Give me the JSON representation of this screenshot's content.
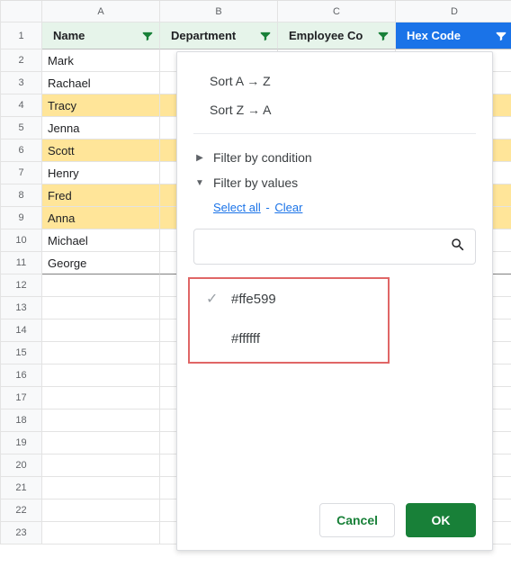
{
  "columns": [
    "A",
    "B",
    "C",
    "D"
  ],
  "row_numbers": [
    1,
    2,
    3,
    4,
    5,
    6,
    7,
    8,
    9,
    10,
    11,
    12,
    13,
    14,
    15,
    16,
    17,
    18,
    19,
    20,
    21,
    22,
    23
  ],
  "headers": {
    "A": "Name",
    "B": "Department",
    "C": "Employee Co",
    "D": "Hex Code"
  },
  "active_filter_col": "D",
  "rows": [
    {
      "name": "Mark",
      "hl": false
    },
    {
      "name": "Rachael",
      "hl": false
    },
    {
      "name": "Tracy",
      "hl": true
    },
    {
      "name": "Jenna",
      "hl": false
    },
    {
      "name": "Scott",
      "hl": true
    },
    {
      "name": "Henry",
      "hl": false
    },
    {
      "name": "Fred",
      "hl": true
    },
    {
      "name": "Anna",
      "hl": true
    },
    {
      "name": "Michael",
      "hl": false
    },
    {
      "name": "George",
      "hl": false
    }
  ],
  "popup": {
    "sort_az": "Sort A → Z",
    "sort_za": "Sort Z → A",
    "filter_condition": "Filter by condition",
    "filter_values": "Filter by values",
    "select_all": "Select all",
    "clear": "Clear",
    "search_placeholder": "",
    "values": [
      {
        "label": "#ffe599",
        "checked": true
      },
      {
        "label": "#ffffff",
        "checked": false
      }
    ],
    "cancel": "Cancel",
    "ok": "OK"
  }
}
